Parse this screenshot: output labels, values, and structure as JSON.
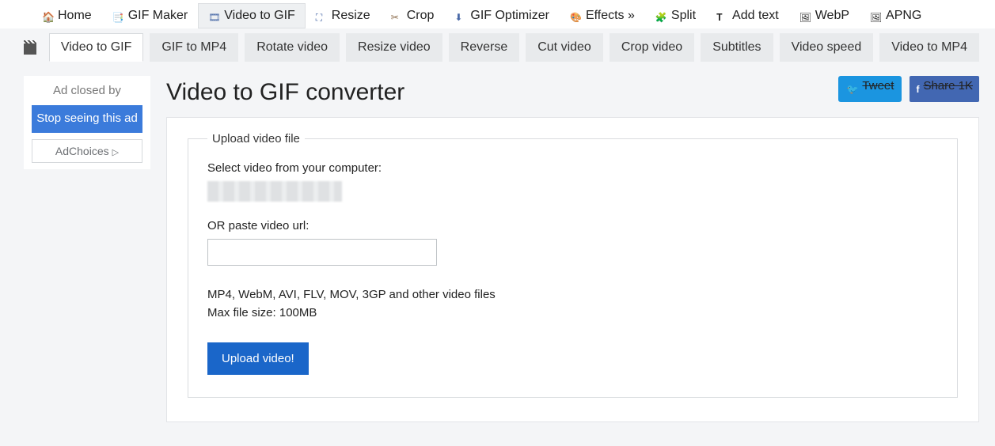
{
  "topnav": [
    {
      "key": "home",
      "label": "Home",
      "icon": "home"
    },
    {
      "key": "gifmaker",
      "label": "GIF Maker",
      "icon": "gif"
    },
    {
      "key": "video2gif",
      "label": "Video to GIF",
      "icon": "video",
      "active": true
    },
    {
      "key": "resize",
      "label": "Resize",
      "icon": "resize"
    },
    {
      "key": "crop",
      "label": "Crop",
      "icon": "crop"
    },
    {
      "key": "optimizer",
      "label": "GIF Optimizer",
      "icon": "opt"
    },
    {
      "key": "effects",
      "label": "Effects »",
      "icon": "eff"
    },
    {
      "key": "split",
      "label": "Split",
      "icon": "split"
    },
    {
      "key": "addtext",
      "label": "Add text",
      "icon": "text"
    },
    {
      "key": "webp",
      "label": "WebP",
      "icon": "webp"
    },
    {
      "key": "apng",
      "label": "APNG",
      "icon": "apng"
    }
  ],
  "tabs": [
    {
      "key": "v2g",
      "label": "Video to GIF",
      "active": true
    },
    {
      "key": "g2m",
      "label": "GIF to MP4"
    },
    {
      "key": "rot",
      "label": "Rotate video"
    },
    {
      "key": "resv",
      "label": "Resize video"
    },
    {
      "key": "rev",
      "label": "Reverse"
    },
    {
      "key": "cut",
      "label": "Cut video"
    },
    {
      "key": "cropv",
      "label": "Crop video"
    },
    {
      "key": "sub",
      "label": "Subtitles"
    },
    {
      "key": "spd",
      "label": "Video speed"
    },
    {
      "key": "v2m",
      "label": "Video to MP4"
    }
  ],
  "ad": {
    "closed_by": "Ad closed by",
    "stop_label": "Stop seeing this ad",
    "choices_label": "AdChoices"
  },
  "page_title": "Video to GIF converter",
  "social": {
    "tweet": "Tweet",
    "share": "Share 1K"
  },
  "form": {
    "legend": "Upload video file",
    "select_label": "Select video from your computer:",
    "url_label": "OR paste video url:",
    "url_value": "",
    "hint_line1": "MP4, WebM, AVI, FLV, MOV, 3GP and other video files",
    "hint_line2": "Max file size: 100MB",
    "upload_btn": "Upload video!"
  }
}
